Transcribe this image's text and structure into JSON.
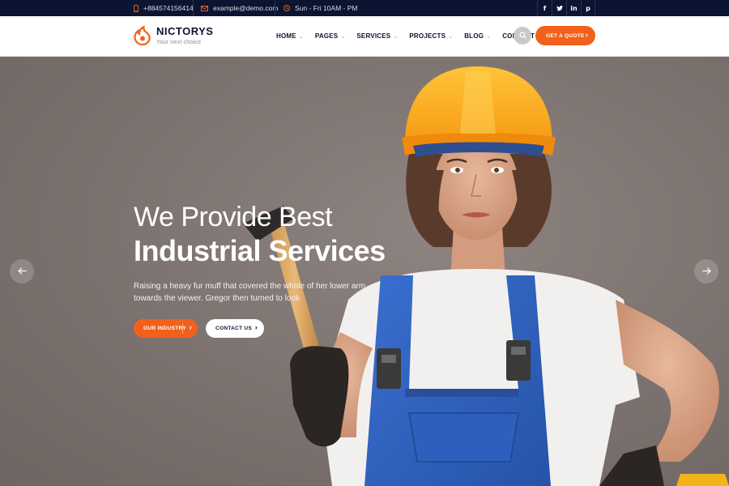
{
  "topbar": {
    "phone": "+884574156414",
    "email": "example@demo.com",
    "hours": "Sun - Fri 10AM - PM",
    "socials": [
      {
        "icon": "facebook-icon",
        "glyph": "f"
      },
      {
        "icon": "twitter-icon",
        "glyph": "t"
      },
      {
        "icon": "linkedin-icon",
        "glyph": "in"
      },
      {
        "icon": "pinterest-icon",
        "glyph": "p"
      }
    ]
  },
  "header": {
    "logo_name": "NICTORYS",
    "logo_tagline": "Your next choice",
    "nav": [
      {
        "label": "HOME",
        "dropdown": true
      },
      {
        "label": "PAGES",
        "dropdown": true
      },
      {
        "label": "SERVICES",
        "dropdown": true
      },
      {
        "label": "PROJECTS",
        "dropdown": true
      },
      {
        "label": "BLOG",
        "dropdown": true
      },
      {
        "label": "CONTACT",
        "dropdown": false
      }
    ],
    "quote_label": "GET A QUOTE"
  },
  "hero": {
    "line1": "We Provide Best",
    "line2": "Industrial Services",
    "description": "Raising a heavy fur muff that covered the whole of her lower arm towards the viewer. Gregor then turned to look",
    "primary_button": "OUR INDUSTRY",
    "secondary_button": "CONTACT US"
  },
  "colors": {
    "accent": "#f2611b",
    "navy": "#0b1430",
    "hero_bg": "#7b716e"
  }
}
